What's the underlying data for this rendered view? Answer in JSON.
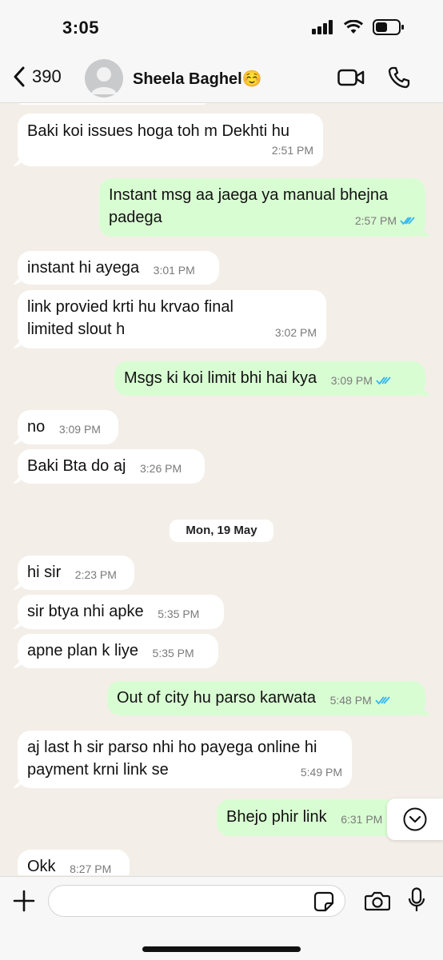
{
  "status": {
    "time": "3:05"
  },
  "header": {
    "back_count": "390",
    "contact_name": "Sheela Baghel",
    "contact_emoji": "☺️"
  },
  "messages": [
    {
      "dir": "in",
      "text": "Baki koi issues hoga toh m Dekhti hu",
      "time": "2:51 PM"
    },
    {
      "dir": "out",
      "text": "Instant msg aa jaega ya manual bhejna padega",
      "time": "2:57 PM",
      "status": "read"
    },
    {
      "dir": "in",
      "text": "instant hi ayega",
      "time": "3:01 PM"
    },
    {
      "dir": "in",
      "text": "link provied krti hu krvao final limited slout h",
      "time": "3:02 PM"
    },
    {
      "dir": "out",
      "text": "Msgs ki koi limit bhi hai kya",
      "time": "3:09 PM",
      "status": "read"
    },
    {
      "dir": "in",
      "text": "no",
      "time": "3:09 PM"
    },
    {
      "dir": "in",
      "text": "Baki Bta do aj",
      "time": "3:26 PM"
    },
    {
      "dir": "in",
      "text": "hi sir",
      "time": "2:23 PM"
    },
    {
      "dir": "in",
      "text": "sir btya nhi apke",
      "time": "5:35 PM"
    },
    {
      "dir": "in",
      "text": "apne plan k liye",
      "time": "5:35 PM"
    },
    {
      "dir": "out",
      "text": "Out of city hu parso karwata",
      "time": "5:48 PM",
      "status": "read"
    },
    {
      "dir": "in",
      "text": "aj last h sir parso nhi ho payega online hi payment krni link se",
      "time": "5:49 PM"
    },
    {
      "dir": "out",
      "text": "Bhejo phir link",
      "time": "6:31 PM"
    },
    {
      "dir": "in",
      "text": "Okk",
      "time": "8:27 PM"
    }
  ],
  "date_separator": "Mon, 19 May",
  "input": {
    "placeholder": ""
  },
  "colors": {
    "incoming": "#ffffff",
    "outgoing": "#d9fdd3",
    "background": "#f3efe8",
    "read_ticks": "#34b7f1"
  },
  "icons": {
    "back": "chevron-left-icon",
    "video": "video-call-icon",
    "call": "phone-icon",
    "plus": "plus-icon",
    "sticker": "sticker-icon",
    "camera": "camera-icon",
    "mic": "microphone-icon",
    "scroll": "chevron-down-icon",
    "status_signal": "signal-icon",
    "status_wifi": "wifi-icon",
    "status_battery": "battery-icon"
  }
}
